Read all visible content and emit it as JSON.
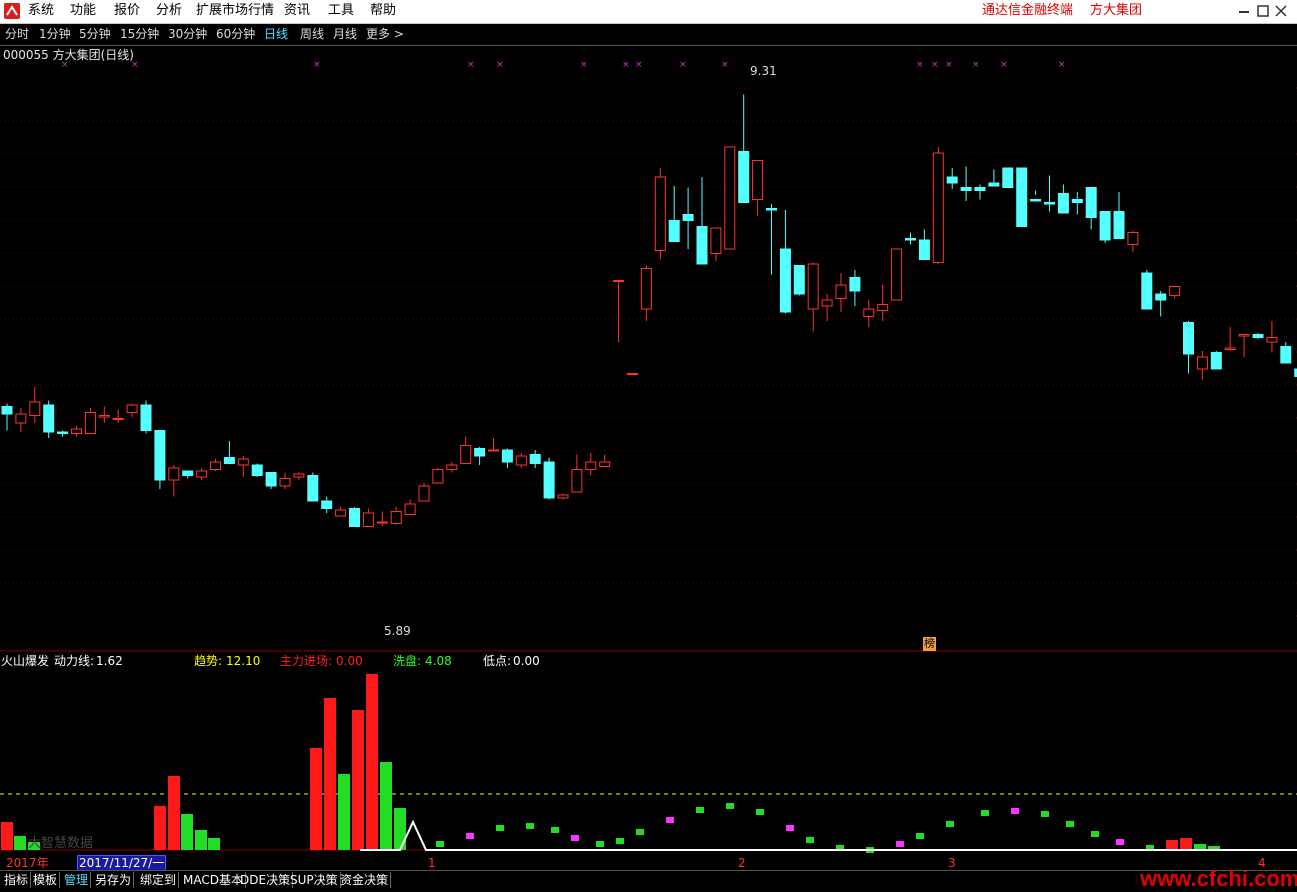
{
  "menu": {
    "items": [
      "系统",
      "功能",
      "报价",
      "分析",
      "扩展市场行情",
      "资讯",
      "工具",
      "帮助"
    ],
    "brand": "通达信金融终端",
    "company": "方大集团"
  },
  "periods": {
    "items": [
      "分时",
      "1分钟",
      "5分钟",
      "15分钟",
      "30分钟",
      "60分钟",
      "日线",
      "周线",
      "月线",
      "更多 >"
    ],
    "active": "日线"
  },
  "main_chart": {
    "title": "000055 方大集团(日线)",
    "high_label": "9.31",
    "low_label": "5.89",
    "board_badge": "榜"
  },
  "indicator": {
    "name": "火山爆发",
    "items": [
      {
        "label": "动力线:",
        "value": "1.62",
        "color": "#ffffff"
      },
      {
        "label": "趋势:",
        "value": "12.10",
        "color": "#ffff00"
      },
      {
        "label": "主力进场:",
        "value": "0.00",
        "color": "#ff2020"
      },
      {
        "label": "洗盘:",
        "value": "4.08",
        "color": "#22ff22"
      },
      {
        "label": "低点:",
        "value": "0.00",
        "color": "#ffffff"
      }
    ],
    "watermark_text": "大智慧数据"
  },
  "axis": {
    "year_label": "2017年",
    "date_cursor": "2017/11/27/一",
    "month_marks": [
      "1",
      "2",
      "3",
      "4"
    ]
  },
  "bottom_tabs": {
    "items": [
      "指标",
      "模板",
      "管理",
      "另存为",
      "绑定到",
      "MACD基本",
      "DDE决策",
      "SUP决策",
      "资金决策"
    ],
    "active": "管理"
  },
  "site_watermark": "www.cfchi.com",
  "colors": {
    "up": "#ff3232",
    "down": "#54ffff",
    "background": "#000000",
    "brand": "#e00000"
  },
  "chart_data": {
    "type": "candlestick",
    "symbol": "000055",
    "name": "方大集团",
    "period": "日线",
    "price_range": [
      5.7,
      9.5
    ],
    "ohlc": [
      [
        7.23,
        7.25,
        7.07,
        7.18
      ],
      [
        7.12,
        7.22,
        7.06,
        7.18
      ],
      [
        7.17,
        7.36,
        7.12,
        7.26
      ],
      [
        7.24,
        7.27,
        7.02,
        7.06
      ],
      [
        7.06,
        7.07,
        7.03,
        7.05
      ],
      [
        7.05,
        7.1,
        7.03,
        7.08
      ],
      [
        7.05,
        7.22,
        7.05,
        7.19
      ],
      [
        7.16,
        7.23,
        7.12,
        7.17
      ],
      [
        7.15,
        7.21,
        7.12,
        7.15
      ],
      [
        7.19,
        7.25,
        7.16,
        7.24
      ],
      [
        7.24,
        7.27,
        7.05,
        7.07
      ],
      [
        7.07,
        7.07,
        6.68,
        6.74
      ],
      [
        6.74,
        6.84,
        6.63,
        6.82
      ],
      [
        6.8,
        6.8,
        6.75,
        6.77
      ],
      [
        6.76,
        6.82,
        6.74,
        6.8
      ],
      [
        6.81,
        6.88,
        6.8,
        6.86
      ],
      [
        6.89,
        7.0,
        6.85,
        6.85
      ],
      [
        6.84,
        6.9,
        6.76,
        6.88
      ],
      [
        6.84,
        6.85,
        6.76,
        6.77
      ],
      [
        6.79,
        6.79,
        6.68,
        6.7
      ],
      [
        6.7,
        6.79,
        6.68,
        6.75
      ],
      [
        6.76,
        6.79,
        6.74,
        6.78
      ],
      [
        6.77,
        6.79,
        6.61,
        6.6
      ],
      [
        6.6,
        6.63,
        6.52,
        6.55
      ],
      [
        6.5,
        6.56,
        6.5,
        6.54
      ],
      [
        6.55,
        6.56,
        6.43,
        6.43
      ],
      [
        6.43,
        6.55,
        6.43,
        6.52
      ],
      [
        6.46,
        6.53,
        6.43,
        6.46
      ],
      [
        6.45,
        6.56,
        6.44,
        6.53
      ],
      [
        6.51,
        6.61,
        6.51,
        6.58
      ],
      [
        6.6,
        6.72,
        6.6,
        6.7
      ],
      [
        6.72,
        6.82,
        6.72,
        6.81
      ],
      [
        6.81,
        6.86,
        6.79,
        6.84
      ],
      [
        6.85,
        7.03,
        6.85,
        6.97
      ],
      [
        6.95,
        6.96,
        6.84,
        6.9
      ],
      [
        6.94,
        7.02,
        6.93,
        6.94
      ],
      [
        6.94,
        6.95,
        6.82,
        6.86
      ],
      [
        6.84,
        6.92,
        6.82,
        6.9
      ],
      [
        6.91,
        6.94,
        6.82,
        6.85
      ],
      [
        6.86,
        6.89,
        6.61,
        6.62
      ],
      [
        6.62,
        6.65,
        6.61,
        6.64
      ],
      [
        6.66,
        6.91,
        6.66,
        6.81
      ],
      [
        6.81,
        6.92,
        6.77,
        6.86
      ],
      [
        6.83,
        6.91,
        6.83,
        6.86
      ],
      [
        8.07,
        8.07,
        7.66,
        8.07
      ],
      [
        7.45,
        7.45,
        7.45,
        7.45
      ],
      [
        7.88,
        8.17,
        7.8,
        8.15
      ],
      [
        8.27,
        8.82,
        8.21,
        8.76
      ],
      [
        8.47,
        8.7,
        8.37,
        8.33
      ],
      [
        8.51,
        8.69,
        8.28,
        8.47
      ],
      [
        8.43,
        8.76,
        8.4,
        8.18
      ],
      [
        8.25,
        8.37,
        8.2,
        8.42
      ],
      [
        8.28,
        8.96,
        8.28,
        8.96
      ],
      [
        8.93,
        9.31,
        8.7,
        8.59
      ],
      [
        8.61,
        8.87,
        8.5,
        8.87
      ],
      [
        8.55,
        8.58,
        8.11,
        8.54
      ],
      [
        8.28,
        8.54,
        7.85,
        7.86
      ],
      [
        8.17,
        8.16,
        7.97,
        7.98
      ],
      [
        7.88,
        8.19,
        7.73,
        8.18
      ],
      [
        7.9,
        7.98,
        7.8,
        7.94
      ],
      [
        7.95,
        8.12,
        7.86,
        8.04
      ],
      [
        8.09,
        8.14,
        7.9,
        8.0
      ],
      [
        7.83,
        7.94,
        7.76,
        7.88
      ],
      [
        7.87,
        8.04,
        7.8,
        7.91
      ],
      [
        7.94,
        8.28,
        7.94,
        8.28
      ],
      [
        8.35,
        8.39,
        8.31,
        8.34
      ],
      [
        8.34,
        8.41,
        8.22,
        8.21
      ],
      [
        8.19,
        8.96,
        8.18,
        8.92
      ],
      [
        8.76,
        8.82,
        8.68,
        8.72
      ],
      [
        8.69,
        8.83,
        8.6,
        8.67
      ],
      [
        8.69,
        8.71,
        8.61,
        8.67
      ],
      [
        8.72,
        8.81,
        8.71,
        8.7
      ],
      [
        8.82,
        8.78,
        8.72,
        8.69
      ],
      [
        8.82,
        8.82,
        8.47,
        8.43
      ],
      [
        8.61,
        8.67,
        8.64,
        8.6
      ],
      [
        8.59,
        8.77,
        8.53,
        8.58
      ],
      [
        8.65,
        8.71,
        8.63,
        8.52
      ],
      [
        8.61,
        8.66,
        8.51,
        8.59
      ],
      [
        8.69,
        8.63,
        8.41,
        8.49
      ],
      [
        8.53,
        8.48,
        8.32,
        8.34
      ],
      [
        8.53,
        8.66,
        8.41,
        8.35
      ],
      [
        8.31,
        8.4,
        8.26,
        8.39
      ],
      [
        8.12,
        8.14,
        7.95,
        7.88
      ],
      [
        7.98,
        8.0,
        7.83,
        7.94
      ],
      [
        7.97,
        8.03,
        7.95,
        8.03
      ],
      [
        7.79,
        7.8,
        7.45,
        7.58
      ],
      [
        7.48,
        7.6,
        7.41,
        7.56
      ],
      [
        7.59,
        7.6,
        7.56,
        7.48
      ],
      [
        7.61,
        7.76,
        7.6,
        7.62
      ],
      [
        7.7,
        7.71,
        7.56,
        7.71
      ],
      [
        7.71,
        7.72,
        7.68,
        7.69
      ],
      [
        7.66,
        7.8,
        7.59,
        7.69
      ],
      [
        7.63,
        7.66,
        7.61,
        7.52
      ],
      [
        7.48,
        7.49,
        7.38,
        7.43
      ]
    ],
    "indicator": {
      "name": "火山爆发",
      "dynamic_line": 1.62,
      "trend": 12.1,
      "main_force_entry": 0.0,
      "wash": 4.08,
      "low_point": 0.0
    }
  }
}
